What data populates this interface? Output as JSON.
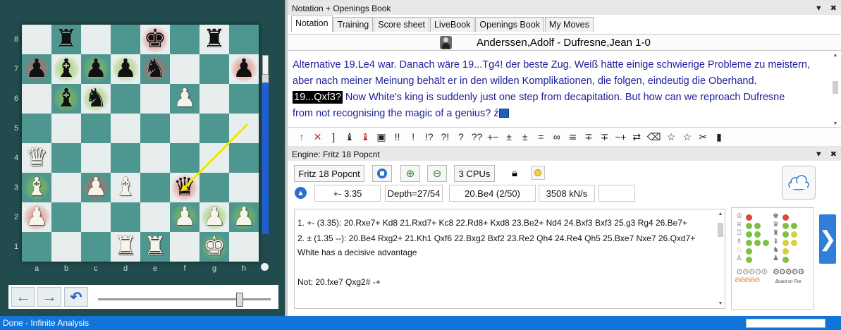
{
  "board": {
    "ranks": [
      "8",
      "7",
      "6",
      "5",
      "4",
      "3",
      "2",
      "1"
    ],
    "files": [
      "a",
      "b",
      "c",
      "d",
      "e",
      "f",
      "g",
      "h"
    ],
    "squares": [
      "r:b8",
      "k:e8",
      "r:g8",
      "p:a7",
      "b:b7",
      "p:c7",
      "p:d7",
      "n:e7",
      "p:h7",
      "b:b6",
      "n:c6",
      "P:f6",
      "Q:a4",
      "B:a3",
      "P:c3",
      "B:d3",
      "q:f3",
      "P:a2",
      "P:f2",
      "P:g2",
      "P:h2",
      "R:d1",
      "R:e1",
      "K:g1"
    ],
    "highlights_red": [
      "e8",
      "a7",
      "e7",
      "h7",
      "c3",
      "f3",
      "a2"
    ],
    "highlights_green": [
      "b7",
      "c7",
      "d7",
      "b6",
      "c6",
      "a3",
      "f2",
      "g2",
      "h2",
      "g1"
    ],
    "arrow": {
      "from": "h5",
      "to": "f3",
      "color": "#f2e600"
    },
    "colors": {
      "light": "#e8eeed",
      "dark": "#4e9690",
      "frame": "#214b4c"
    }
  },
  "navigation": {
    "back": "←",
    "forward": "→",
    "undo": "↶",
    "slider_position": 0.82
  },
  "notation": {
    "title": "Notation + Openings Book",
    "controls": [
      "▼",
      "✖"
    ],
    "tabs": [
      "Notation",
      "Training",
      "Score sheet",
      "LiveBook",
      "Openings Book",
      "My Moves"
    ],
    "active_tab": "Notation",
    "game_title": "Anderssen,Adolf - Dufresne,Jean  1-0",
    "text_line1": "Alternative 19.Le4 war. Danach wäre 19...Tg4! der beste Zug. Weiß hätte einige schwierige Probleme zu meistern,",
    "text_line2": "aber nach meiner Meinung behält er in den wilden Komplikationen, die folgen, eindeutig die Oberhand.",
    "current_move": "19...Qxf3?",
    "text_line3": " Now White's king is suddenly just one step from decapitation. But how can we reproach Dufresne",
    "text_line4": "from not recognising the magic of a genius? ",
    "text_tail_icon": "ź",
    "annotation_symbols": [
      "↑",
      "✕",
      "]",
      "♝",
      "♝",
      "▣",
      "!!",
      "!",
      "!?",
      "?!",
      "?",
      "??",
      "+−",
      "±",
      "±",
      "=",
      "∞",
      "≅",
      "∓",
      "∓",
      "−+",
      "⇄",
      "⌫",
      "☆",
      "☆",
      "✂",
      "▮"
    ]
  },
  "engine": {
    "title": "Engine: Fritz 18 Popcnt",
    "controls": [
      "▼",
      "✖"
    ],
    "name": "Fritz 18 Popcnt",
    "stop_icon": "stop-icon",
    "cpus": "3 CPUs",
    "eval": "+- 3.35",
    "depth": "Depth=27/54",
    "current_move": "20.Be4 (2/50)",
    "speed": "3508 kN/s",
    "blank_field": "",
    "lines": [
      "1. +- (3.35): 20.Rxe7+ Kd8 21.Rxd7+ Kc8 22.Rd8+ Kxd8 23.Be2+ Nd4 24.Bxf3 Bxf3 25.g3 Rg4 26.Be7+",
      "2. ± (1.35 --): 20.Be4 Rxg2+ 21.Kh1 Qxf6 22.Bxg2 Bxf2 23.Re2 Qh4 24.Re4 Qh5 25.Bxe7 Nxe7 26.Qxd7+",
      "White has a decisive advantage",
      "",
      "Not: 20.fxe7 Qxg2#  -+"
    ],
    "board_on_fire": "Board on Fire",
    "next_arrow": "❯"
  },
  "status": {
    "text": "Done - Infinite Analysis",
    "bar_color": "#1174d6"
  }
}
